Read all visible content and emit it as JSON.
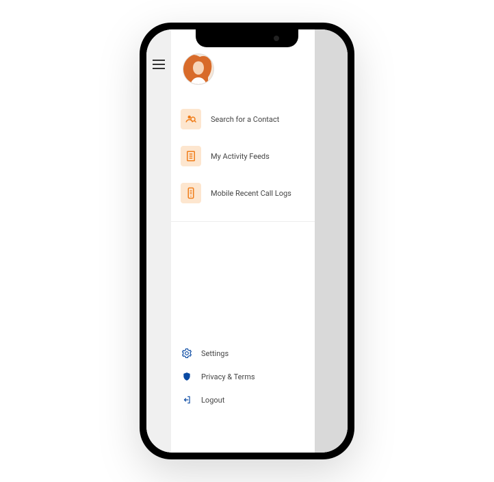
{
  "menu": {
    "primary": [
      {
        "label": "Search for a Contact"
      },
      {
        "label": "My Activity Feeds"
      },
      {
        "label": "Mobile Recent Call Logs"
      }
    ],
    "secondary": [
      {
        "label": "Settings"
      },
      {
        "label": "Privacy & Terms"
      },
      {
        "label": "Logout"
      }
    ]
  }
}
